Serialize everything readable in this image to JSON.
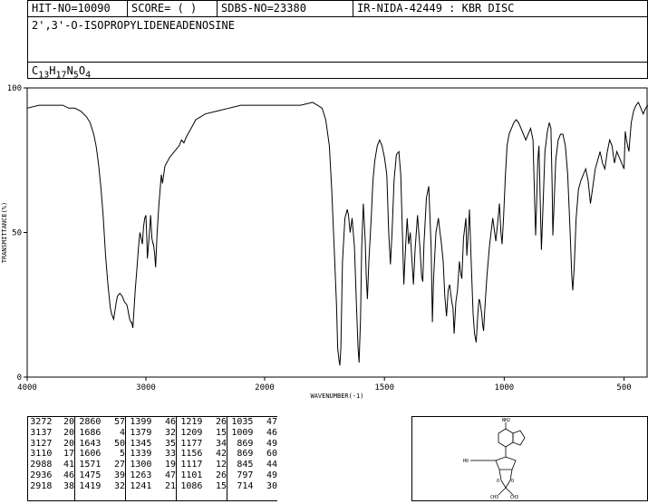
{
  "header": {
    "hit_no": "HIT-NO=10090",
    "score": "SCORE=  (   )",
    "sdbs_no": "SDBS-NO=23380",
    "ir_nida": "IR-NIDA-42449 : KBR DISC"
  },
  "compound": {
    "name": "2',3'-O-ISOPROPYLIDENEADENOSINE",
    "formula_parts": [
      "C",
      "13",
      "H",
      "17",
      "N",
      "5",
      "O",
      "4"
    ]
  },
  "chart_data": {
    "type": "line",
    "xlabel": "WAVENUMBER(-1)",
    "ylabel": "TRANSMITTANCE(%)",
    "xlim": [
      4000,
      400
    ],
    "ylim": [
      0,
      100
    ],
    "x_ticks": [
      4000,
      3000,
      2000,
      1500,
      1000,
      500
    ],
    "y_ticks": [
      0,
      50,
      100
    ],
    "grid": false,
    "series": [
      {
        "points": [
          [
            4000,
            93
          ],
          [
            3900,
            94
          ],
          [
            3800,
            94
          ],
          [
            3700,
            94
          ],
          [
            3650,
            93
          ],
          [
            3600,
            93
          ],
          [
            3550,
            92
          ],
          [
            3500,
            90
          ],
          [
            3470,
            88
          ],
          [
            3440,
            84
          ],
          [
            3420,
            80
          ],
          [
            3400,
            74
          ],
          [
            3380,
            66
          ],
          [
            3360,
            56
          ],
          [
            3340,
            42
          ],
          [
            3320,
            32
          ],
          [
            3300,
            24
          ],
          [
            3290,
            22
          ],
          [
            3272,
            20
          ],
          [
            3260,
            23
          ],
          [
            3250,
            26
          ],
          [
            3240,
            28
          ],
          [
            3220,
            29
          ],
          [
            3200,
            28
          ],
          [
            3180,
            26
          ],
          [
            3160,
            25
          ],
          [
            3150,
            23
          ],
          [
            3137,
            20
          ],
          [
            3127,
            19
          ],
          [
            3120,
            19
          ],
          [
            3110,
            17
          ],
          [
            3105,
            20
          ],
          [
            3090,
            30
          ],
          [
            3075,
            38
          ],
          [
            3060,
            46
          ],
          [
            3050,
            50
          ],
          [
            3040,
            48
          ],
          [
            3030,
            46
          ],
          [
            3020,
            52
          ],
          [
            3010,
            55
          ],
          [
            3000,
            56
          ],
          [
            2992,
            48
          ],
          [
            2988,
            41
          ],
          [
            2982,
            44
          ],
          [
            2970,
            50
          ],
          [
            2960,
            56
          ],
          [
            2950,
            48
          ],
          [
            2940,
            46
          ],
          [
            2936,
            46
          ],
          [
            2925,
            42
          ],
          [
            2918,
            38
          ],
          [
            2905,
            50
          ],
          [
            2890,
            60
          ],
          [
            2870,
            70
          ],
          [
            2860,
            67
          ],
          [
            2840,
            73
          ],
          [
            2800,
            76
          ],
          [
            2760,
            78
          ],
          [
            2720,
            80
          ],
          [
            2700,
            82
          ],
          [
            2680,
            81
          ],
          [
            2660,
            83
          ],
          [
            2620,
            86
          ],
          [
            2580,
            89
          ],
          [
            2540,
            90
          ],
          [
            2500,
            91
          ],
          [
            2400,
            92
          ],
          [
            2300,
            93
          ],
          [
            2200,
            94
          ],
          [
            2100,
            94
          ],
          [
            2000,
            94
          ],
          [
            1900,
            94
          ],
          [
            1850,
            94
          ],
          [
            1800,
            95
          ],
          [
            1780,
            94
          ],
          [
            1760,
            93
          ],
          [
            1745,
            89
          ],
          [
            1730,
            80
          ],
          [
            1720,
            65
          ],
          [
            1710,
            45
          ],
          [
            1700,
            25
          ],
          [
            1695,
            10
          ],
          [
            1690,
            6
          ],
          [
            1686,
            4
          ],
          [
            1682,
            10
          ],
          [
            1675,
            40
          ],
          [
            1665,
            55
          ],
          [
            1655,
            58
          ],
          [
            1650,
            56
          ],
          [
            1643,
            50
          ],
          [
            1635,
            55
          ],
          [
            1625,
            45
          ],
          [
            1617,
            25
          ],
          [
            1610,
            10
          ],
          [
            1606,
            5
          ],
          [
            1600,
            20
          ],
          [
            1595,
            45
          ],
          [
            1588,
            60
          ],
          [
            1580,
            47
          ],
          [
            1576,
            35
          ],
          [
            1571,
            27
          ],
          [
            1565,
            40
          ],
          [
            1555,
            55
          ],
          [
            1548,
            68
          ],
          [
            1540,
            75
          ],
          [
            1530,
            80
          ],
          [
            1520,
            82
          ],
          [
            1510,
            80
          ],
          [
            1500,
            76
          ],
          [
            1490,
            70
          ],
          [
            1482,
            50
          ],
          [
            1475,
            39
          ],
          [
            1468,
            50
          ],
          [
            1460,
            68
          ],
          [
            1450,
            77
          ],
          [
            1440,
            78
          ],
          [
            1432,
            70
          ],
          [
            1425,
            50
          ],
          [
            1419,
            32
          ],
          [
            1412,
            45
          ],
          [
            1405,
            55
          ],
          [
            1399,
            46
          ],
          [
            1392,
            50
          ],
          [
            1385,
            40
          ],
          [
            1379,
            32
          ],
          [
            1372,
            44
          ],
          [
            1362,
            56
          ],
          [
            1352,
            45
          ],
          [
            1345,
            35
          ],
          [
            1340,
            33
          ],
          [
            1335,
            46
          ],
          [
            1325,
            62
          ],
          [
            1315,
            66
          ],
          [
            1305,
            45
          ],
          [
            1300,
            19
          ],
          [
            1295,
            34
          ],
          [
            1285,
            50
          ],
          [
            1275,
            55
          ],
          [
            1268,
            50
          ],
          [
            1263,
            47
          ],
          [
            1255,
            40
          ],
          [
            1248,
            28
          ],
          [
            1241,
            21
          ],
          [
            1234,
            30
          ],
          [
            1228,
            32
          ],
          [
            1219,
            26
          ],
          [
            1214,
            24
          ],
          [
            1209,
            15
          ],
          [
            1202,
            26
          ],
          [
            1195,
            30
          ],
          [
            1187,
            40
          ],
          [
            1182,
            36
          ],
          [
            1177,
            34
          ],
          [
            1170,
            48
          ],
          [
            1160,
            55
          ],
          [
            1156,
            42
          ],
          [
            1150,
            50
          ],
          [
            1145,
            58
          ],
          [
            1138,
            40
          ],
          [
            1130,
            22
          ],
          [
            1124,
            15
          ],
          [
            1117,
            12
          ],
          [
            1110,
            22
          ],
          [
            1105,
            27
          ],
          [
            1101,
            26
          ],
          [
            1094,
            22
          ],
          [
            1090,
            18
          ],
          [
            1086,
            16
          ],
          [
            1080,
            25
          ],
          [
            1072,
            35
          ],
          [
            1062,
            45
          ],
          [
            1055,
            50
          ],
          [
            1048,
            55
          ],
          [
            1040,
            50
          ],
          [
            1035,
            47
          ],
          [
            1028,
            53
          ],
          [
            1020,
            60
          ],
          [
            1014,
            50
          ],
          [
            1009,
            46
          ],
          [
            1003,
            55
          ],
          [
            995,
            70
          ],
          [
            988,
            80
          ],
          [
            980,
            84
          ],
          [
            970,
            86
          ],
          [
            960,
            88
          ],
          [
            950,
            89
          ],
          [
            940,
            88
          ],
          [
            930,
            86
          ],
          [
            920,
            84
          ],
          [
            910,
            82
          ],
          [
            900,
            84
          ],
          [
            890,
            86
          ],
          [
            880,
            82
          ],
          [
            873,
            60
          ],
          [
            869,
            49
          ],
          [
            865,
            60
          ],
          [
            860,
            75
          ],
          [
            855,
            80
          ],
          [
            850,
            62
          ],
          [
            845,
            44
          ],
          [
            840,
            55
          ],
          [
            830,
            78
          ],
          [
            820,
            85
          ],
          [
            812,
            88
          ],
          [
            805,
            86
          ],
          [
            800,
            65
          ],
          [
            797,
            49
          ],
          [
            792,
            60
          ],
          [
            785,
            75
          ],
          [
            775,
            82
          ],
          [
            765,
            84
          ],
          [
            755,
            84
          ],
          [
            745,
            80
          ],
          [
            735,
            70
          ],
          [
            725,
            50
          ],
          [
            718,
            35
          ],
          [
            714,
            30
          ],
          [
            708,
            38
          ],
          [
            700,
            55
          ],
          [
            690,
            65
          ],
          [
            680,
            68
          ],
          [
            670,
            70
          ],
          [
            660,
            72
          ],
          [
            650,
            68
          ],
          [
            640,
            60
          ],
          [
            630,
            66
          ],
          [
            620,
            72
          ],
          [
            610,
            75
          ],
          [
            600,
            78
          ],
          [
            590,
            74
          ],
          [
            580,
            72
          ],
          [
            570,
            78
          ],
          [
            560,
            82
          ],
          [
            550,
            80
          ],
          [
            540,
            74
          ],
          [
            530,
            78
          ],
          [
            520,
            76
          ],
          [
            510,
            74
          ],
          [
            500,
            72
          ],
          [
            495,
            85
          ],
          [
            490,
            82
          ],
          [
            480,
            78
          ],
          [
            470,
            88
          ],
          [
            460,
            92
          ],
          [
            450,
            94
          ],
          [
            440,
            95
          ],
          [
            430,
            93
          ],
          [
            420,
            91
          ],
          [
            410,
            93
          ],
          [
            400,
            94
          ]
        ]
      }
    ],
    "peaks": [
      [
        3272,
        20
      ],
      [
        3137,
        20
      ],
      [
        3127,
        20
      ],
      [
        3110,
        17
      ],
      [
        2988,
        41
      ],
      [
        2936,
        46
      ],
      [
        2918,
        38
      ],
      [
        2860,
        57
      ],
      [
        1686,
        4
      ],
      [
        1643,
        50
      ],
      [
        1606,
        5
      ],
      [
        1571,
        27
      ],
      [
        1475,
        39
      ],
      [
        1419,
        32
      ],
      [
        1399,
        46
      ],
      [
        1379,
        32
      ],
      [
        1345,
        35
      ],
      [
        1339,
        33
      ],
      [
        1300,
        19
      ],
      [
        1263,
        47
      ],
      [
        1241,
        21
      ],
      [
        1219,
        26
      ],
      [
        1209,
        15
      ],
      [
        1177,
        34
      ],
      [
        1156,
        42
      ],
      [
        1117,
        12
      ],
      [
        1101,
        26
      ],
      [
        1086,
        15
      ],
      [
        1035,
        47
      ],
      [
        1009,
        46
      ],
      [
        869,
        49
      ],
      [
        869,
        60
      ],
      [
        845,
        44
      ],
      [
        797,
        49
      ],
      [
        714,
        30
      ]
    ]
  },
  "structure_image": "2',3'-O-isopropylideneadenosine-structure"
}
